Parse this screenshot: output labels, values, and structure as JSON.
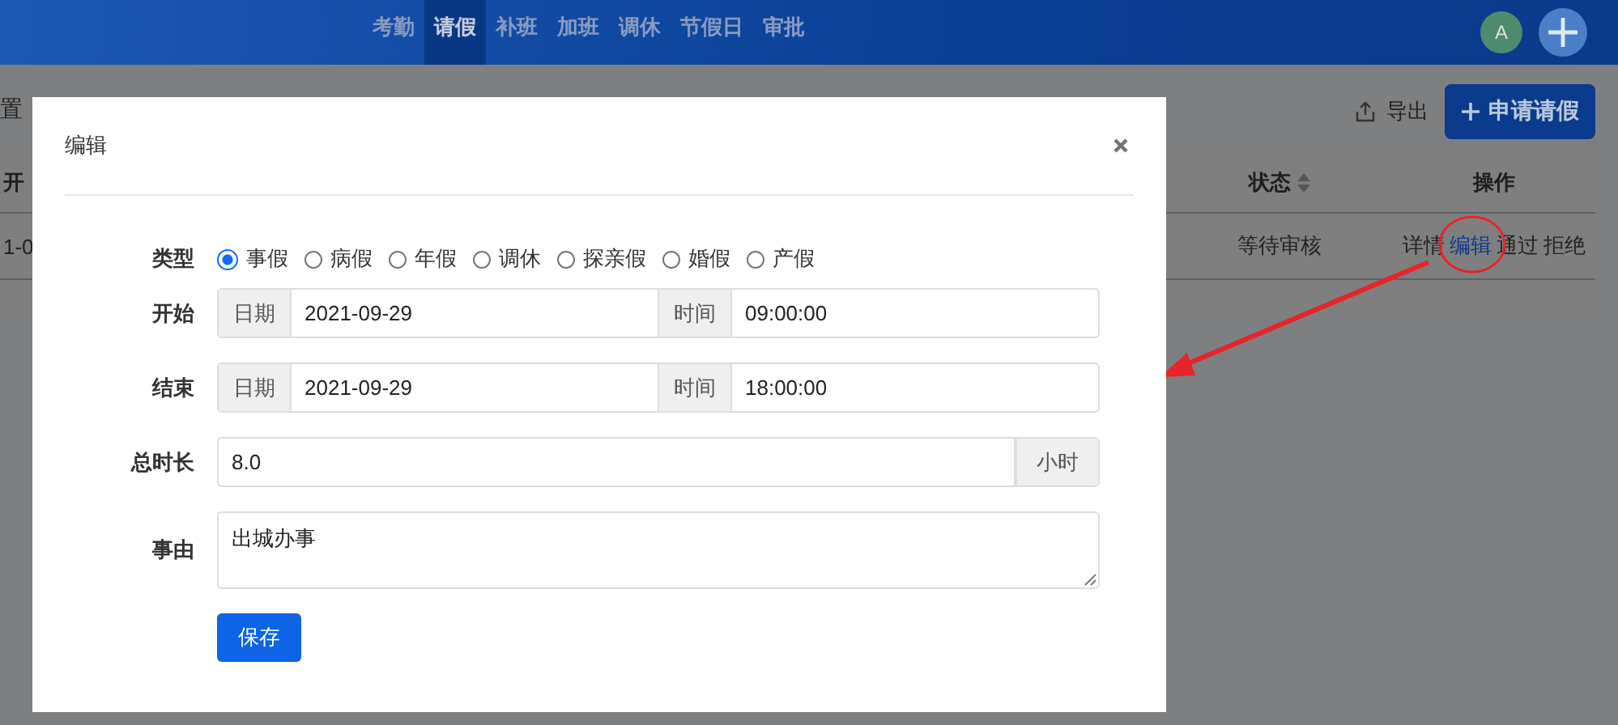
{
  "nav": {
    "items": [
      {
        "label": "考勤",
        "selected": false
      },
      {
        "label": "请假",
        "selected": true
      },
      {
        "label": "补班",
        "selected": false
      },
      {
        "label": "加班",
        "selected": false
      },
      {
        "label": "调休",
        "selected": false
      },
      {
        "label": "节假日",
        "selected": false
      },
      {
        "label": "审批",
        "selected": false
      }
    ],
    "avatar": "A"
  },
  "toolbar": {
    "left_text": "置",
    "export": "导出",
    "apply": "申请请假"
  },
  "table": {
    "columns": [
      {
        "label": "开",
        "sortable": false
      },
      {
        "label": "状态",
        "sortable": true
      },
      {
        "label": "操作",
        "sortable": false
      }
    ],
    "rows": [
      {
        "cells": [
          "1-0",
          "等待审核"
        ],
        "actions": [
          {
            "label": "详情",
            "highlighted": false
          },
          {
            "label": "编辑",
            "highlighted": true
          },
          {
            "label": "通过",
            "highlighted": false
          },
          {
            "label": "拒绝",
            "highlighted": false
          }
        ]
      }
    ]
  },
  "dialog": {
    "title": "编辑",
    "fields": [
      {
        "kind": "radio",
        "label": "类型",
        "options": [
          {
            "label": "事假",
            "selected": true
          },
          {
            "label": "病假",
            "selected": false
          },
          {
            "label": "年假",
            "selected": false
          },
          {
            "label": "调休",
            "selected": false
          },
          {
            "label": "探亲假",
            "selected": false
          },
          {
            "label": "婚假",
            "selected": false
          },
          {
            "label": "产假",
            "selected": false
          }
        ]
      },
      {
        "kind": "datetime",
        "label": "开始",
        "date_addon": "日期",
        "date": "2021-09-29",
        "time_addon": "时间",
        "time": "09:00:00"
      },
      {
        "kind": "datetime",
        "label": "结束",
        "date_addon": "日期",
        "date": "2021-09-29",
        "time_addon": "时间",
        "time": "18:00:00"
      },
      {
        "kind": "number",
        "label": "总时长",
        "value": "8.0",
        "addon": "小时"
      },
      {
        "kind": "textarea",
        "label": "事由",
        "value": "出城办事"
      }
    ],
    "save": "保存"
  }
}
